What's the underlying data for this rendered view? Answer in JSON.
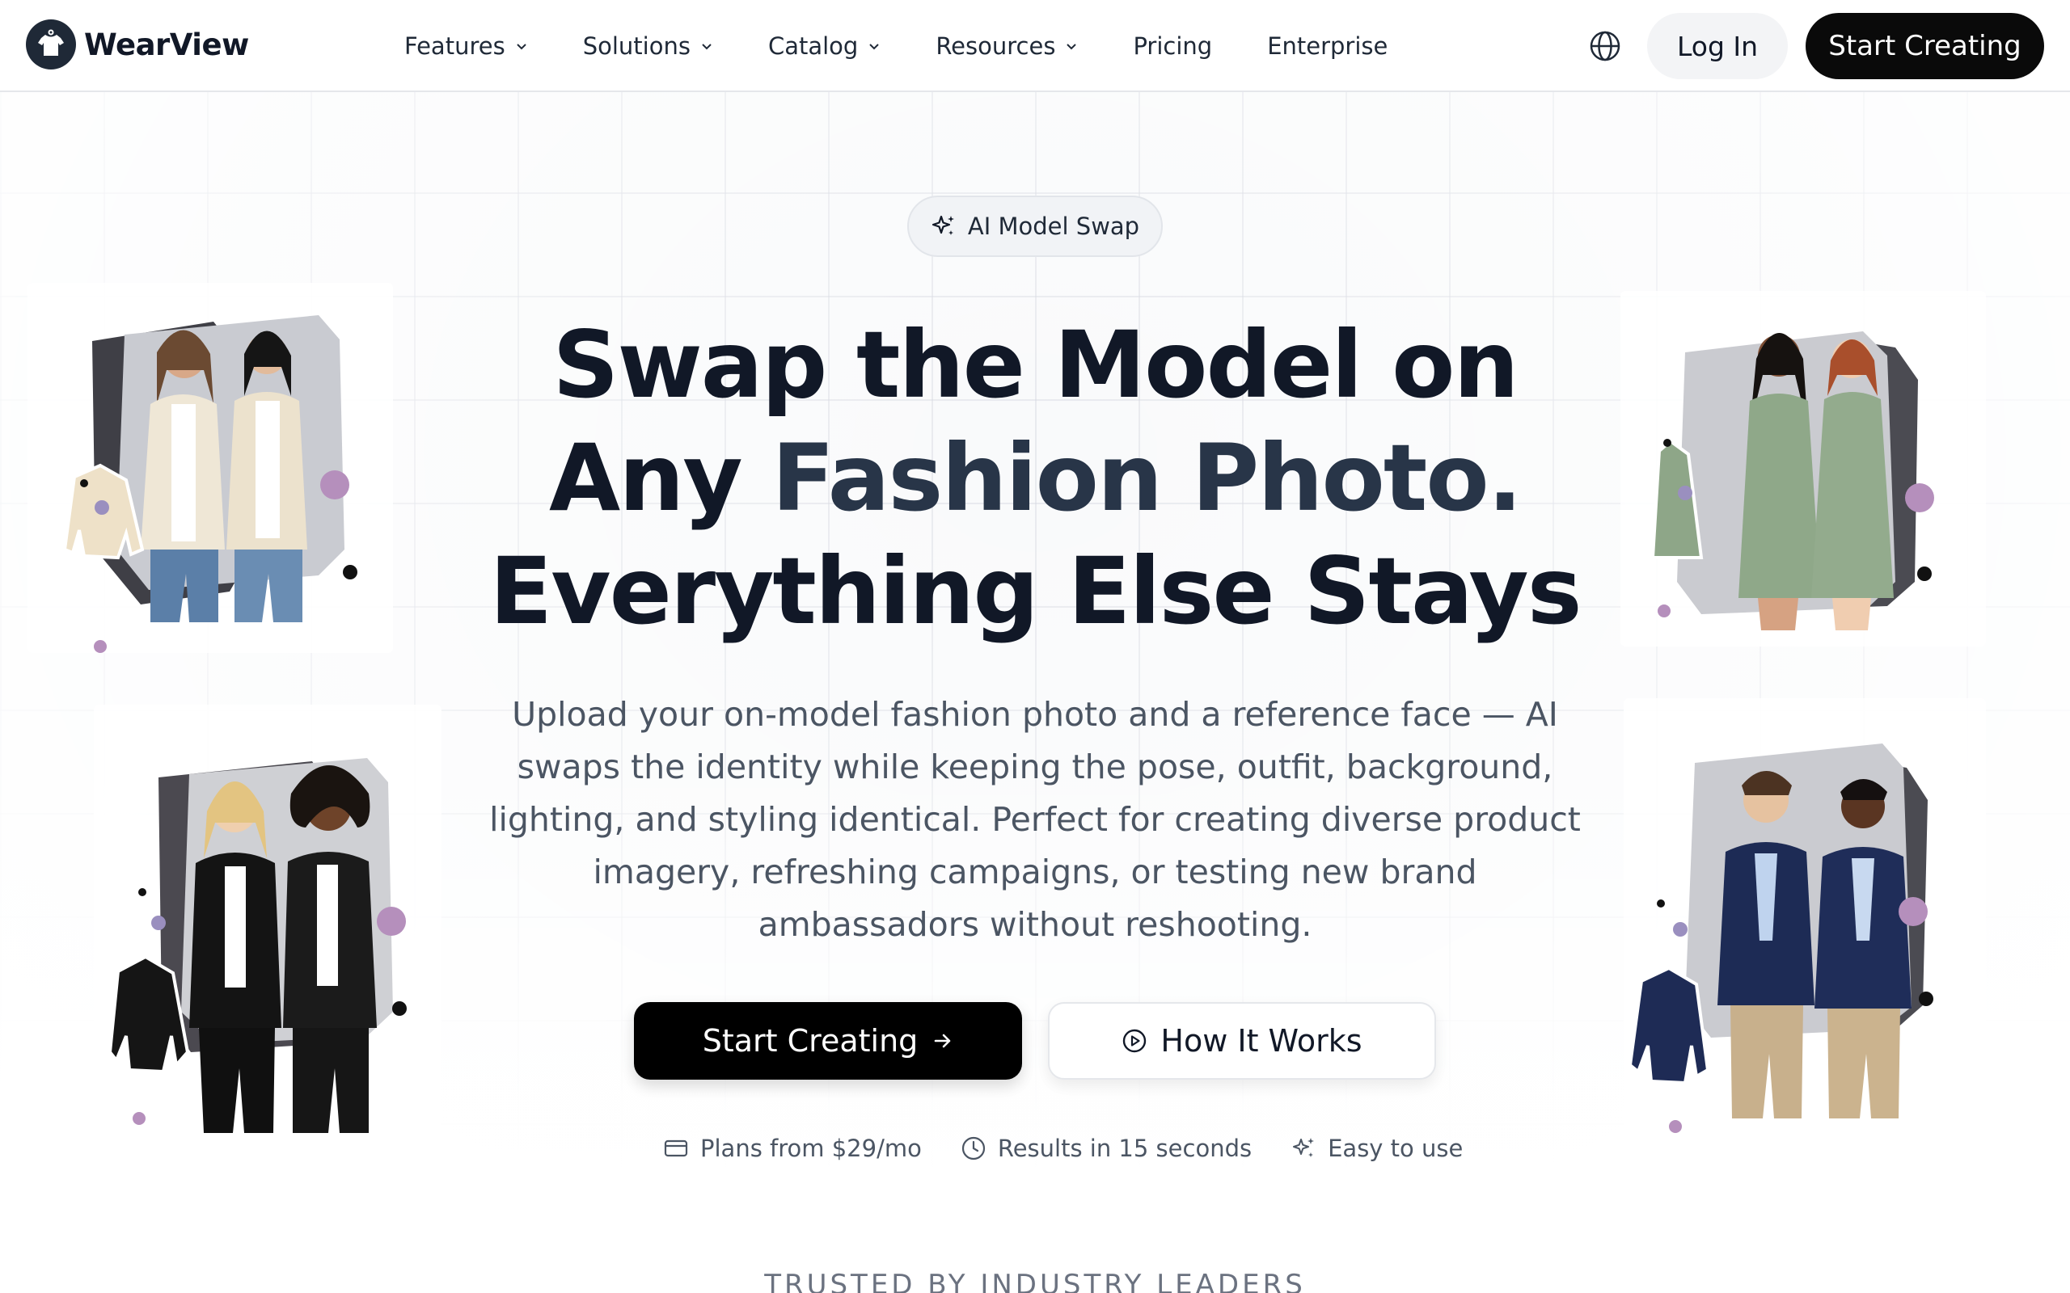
{
  "brand": {
    "name": "WearView"
  },
  "nav": {
    "items": [
      {
        "label": "Features",
        "has_dropdown": true
      },
      {
        "label": "Solutions",
        "has_dropdown": true
      },
      {
        "label": "Catalog",
        "has_dropdown": true
      },
      {
        "label": "Resources",
        "has_dropdown": true
      },
      {
        "label": "Pricing",
        "has_dropdown": false
      },
      {
        "label": "Enterprise",
        "has_dropdown": false
      }
    ],
    "language_icon": "globe-icon",
    "login_label": "Log In",
    "cta_label": "Start Creating"
  },
  "hero": {
    "badge": "AI Model Swap",
    "headline_line1": "Swap the Model on",
    "headline_line2_a": "Any ",
    "headline_line2_b": "Fashion Photo.",
    "headline_line3": "Everything Else Stays",
    "subtitle": "Upload your on-model fashion photo and a reference face — AI swaps the identity while keeping the pose, outfit, background, lighting, and styling identical. Perfect for creating diverse product imagery, refreshing campaigns, or testing new brand ambassadors without reshooting.",
    "primary_cta": "Start Creating",
    "secondary_cta": "How It Works",
    "features": [
      {
        "icon": "credit-card-icon",
        "label": "Plans from $29/mo"
      },
      {
        "icon": "clock-icon",
        "label": "Results in 15 seconds"
      },
      {
        "icon": "sparkles-icon",
        "label": "Easy to use"
      }
    ]
  },
  "trusted_heading": "TRUSTED BY INDUSTRY LEADERS",
  "colors": {
    "primary": "#000000",
    "text": "#111827",
    "accent_text": "#283548",
    "muted_text": "#4b5563",
    "dot_purple": "#b58fbc"
  }
}
